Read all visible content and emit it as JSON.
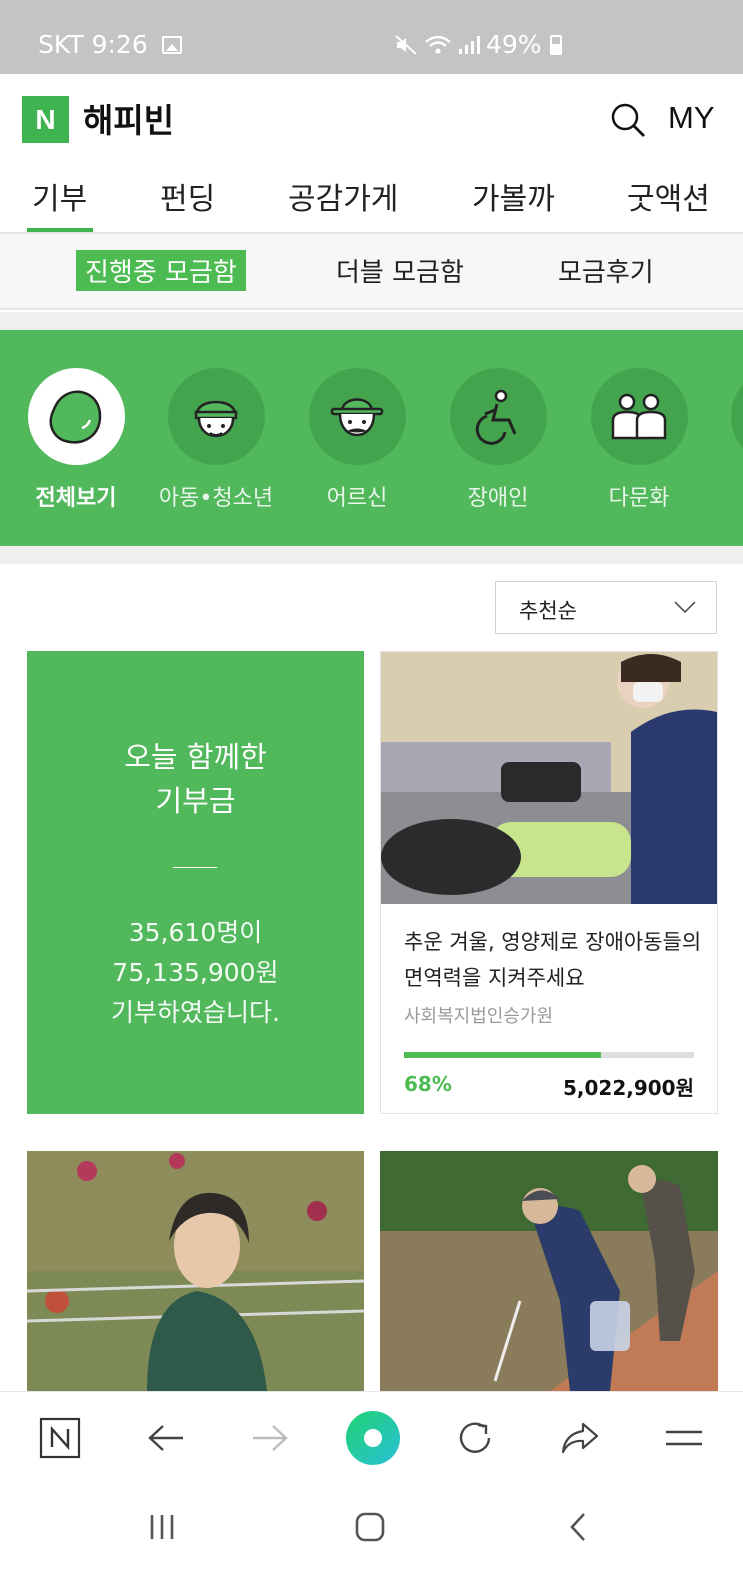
{
  "status_bar": {
    "carrier": "SKT",
    "time": "9:26",
    "battery": "49%"
  },
  "header": {
    "logo_letter": "N",
    "brand": "해피빈",
    "my_label": "MY",
    "icons": [
      "search-icon"
    ]
  },
  "tabs": [
    {
      "label": "기부",
      "active": true
    },
    {
      "label": "펀딩"
    },
    {
      "label": "공감가게"
    },
    {
      "label": "가볼까"
    },
    {
      "label": "굿액션"
    }
  ],
  "subtabs": [
    {
      "label": "진행중 모금함",
      "active": true
    },
    {
      "label": "더블 모금함"
    },
    {
      "label": "모금후기"
    }
  ],
  "categories": [
    {
      "label": "전체보기",
      "icon": "bean-icon",
      "active": true
    },
    {
      "label": "아동•청소년",
      "icon": "child-icon"
    },
    {
      "label": "어르신",
      "icon": "elder-icon"
    },
    {
      "label": "장애인",
      "icon": "wheelchair-icon"
    },
    {
      "label": "다문화",
      "icon": "people-icon"
    }
  ],
  "sort": {
    "selected": "추천순"
  },
  "summary": {
    "title": "오늘 함께한\n기부금",
    "line1": "35,610명이",
    "line2": "75,135,900원",
    "line3": "기부하였습니다."
  },
  "campaign": {
    "title": "추운 겨울, 영양제로 장애아동들의 면역력을 지켜주세요",
    "org": "사회복지법인승가원",
    "progress_percent": 68,
    "percent_label": "68%",
    "amount": "5,022,900원"
  },
  "colors": {
    "brand_green": "#52b85c",
    "accent_green": "#4cbb52"
  },
  "toolbar_icons": [
    "naver-home-icon",
    "back-arrow-icon",
    "forward-arrow-icon",
    "green-dot-icon",
    "refresh-icon",
    "share-icon",
    "menu-icon"
  ],
  "system_nav_icons": [
    "recent-apps-icon",
    "home-icon",
    "back-icon"
  ]
}
